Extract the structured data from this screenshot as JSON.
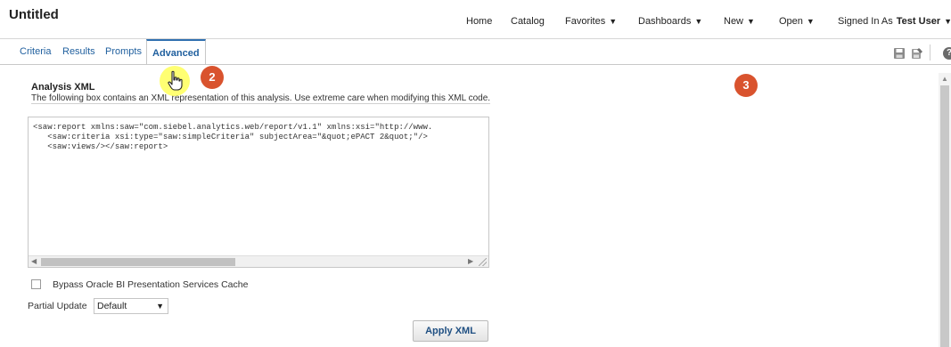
{
  "app": {
    "title": "Untitled"
  },
  "global_nav": {
    "items": [
      {
        "label": "Home",
        "has_menu": false
      },
      {
        "label": "Catalog",
        "has_menu": false
      },
      {
        "label": "Favorites",
        "has_menu": true
      },
      {
        "label": "Dashboards",
        "has_menu": true
      },
      {
        "label": "New",
        "has_menu": true
      },
      {
        "label": "Open",
        "has_menu": true
      }
    ],
    "signed_in_label": "Signed In As",
    "user_name": "Test User",
    "caret": "▼"
  },
  "tabs": [
    {
      "label": "Criteria",
      "active": false
    },
    {
      "label": "Results",
      "active": false
    },
    {
      "label": "Prompts",
      "active": false
    },
    {
      "label": "Advanced",
      "active": true
    }
  ],
  "toolbar": {
    "icons": [
      "save-icon",
      "save-as-icon",
      "help-icon"
    ],
    "help_glyph": "?"
  },
  "analysis_xml": {
    "title": "Analysis XML",
    "description": "The following box contains an XML representation of this analysis. Use extreme care when modifying this XML code.",
    "xml_lines": [
      "<saw:report xmlns:saw=\"com.siebel.analytics.web/report/v1.1\" xmlns:xsi=\"http://www.",
      "   <saw:criteria xsi:type=\"saw:simpleCriteria\" subjectArea=\"&quot;ePACT 2&quot;\"/>",
      "   <saw:views/></saw:report>"
    ]
  },
  "bypass_cache": {
    "label": "Bypass Oracle BI Presentation Services Cache",
    "checked": false
  },
  "partial_update": {
    "label": "Partial Update",
    "value": "Default"
  },
  "apply_button": {
    "label": "Apply XML"
  },
  "annotations": [
    {
      "number": "2",
      "color": "#d9532e"
    },
    {
      "number": "3",
      "color": "#d9532e"
    }
  ],
  "colors": {
    "accent": "#2f6fb0",
    "link": "#1f5f9e",
    "badge": "#d9532e",
    "highlight": "#ffff5a"
  }
}
